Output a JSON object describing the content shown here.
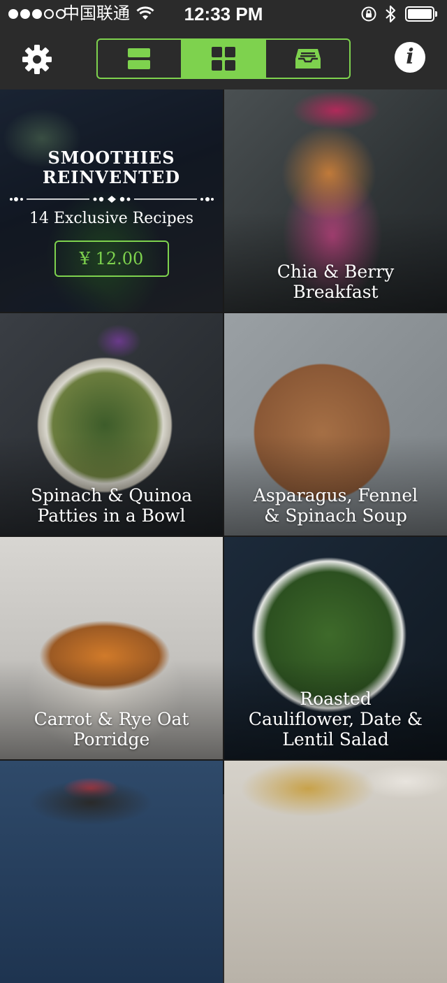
{
  "status_bar": {
    "carrier": "中国联通",
    "time": "12:33 PM",
    "signal_bars_filled": 3,
    "signal_bars_total": 5
  },
  "nav": {
    "settings_icon": "gear-icon",
    "info_icon": "info-icon",
    "info_label": "i",
    "view_modes": [
      {
        "name": "list-view",
        "icon": "list-icon",
        "active": false
      },
      {
        "name": "grid-view",
        "icon": "grid-icon",
        "active": true
      },
      {
        "name": "archive-view",
        "icon": "inbox-icon",
        "active": false
      }
    ]
  },
  "promo": {
    "title_line1": "SMOOTHIES",
    "title_line2": "REINVENTED",
    "subtitle": "14 Exclusive Recipes",
    "price": "¥ 12.00"
  },
  "recipes": [
    {
      "title_line1": "Chia & Berry",
      "title_line2": "Breakfast"
    },
    {
      "title_line1": "Spinach & Quinoa",
      "title_line2": "Patties in a Bowl"
    },
    {
      "title_line1": "Asparagus, Fennel",
      "title_line2": "& Spinach Soup"
    },
    {
      "title_line1": "Carrot & Rye Oat",
      "title_line2": "Porridge"
    },
    {
      "title_line1": "Roasted",
      "title_line2": "Cauliflower, Date &",
      "title_line3": "Lentil Salad"
    }
  ],
  "colors": {
    "accent": "#7ed24e",
    "bar_background": "#2b2b2b",
    "text": "#ffffff"
  }
}
